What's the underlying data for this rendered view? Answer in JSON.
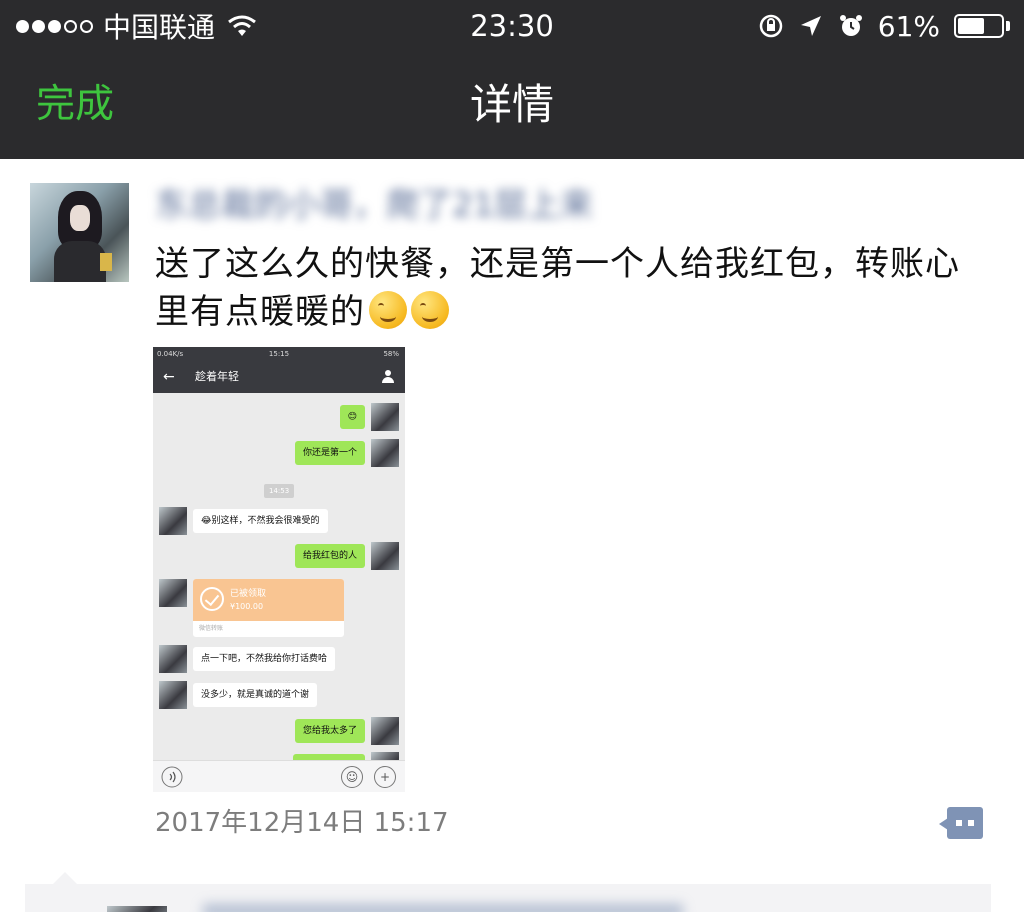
{
  "status_bar": {
    "carrier": "中国联通",
    "time": "23:30",
    "battery": "61%",
    "battery_level": 0.61,
    "icons": [
      "signal-dots",
      "wifi-icon",
      "rotation-lock-icon",
      "location-arrow-icon",
      "alarm-icon",
      "battery-icon"
    ]
  },
  "nav": {
    "done_label": "完成",
    "title": "详情"
  },
  "post": {
    "author": "东总裁的小哥，爬了21层上来",
    "text_line1": "送了这么久的快餐，还是第一个人给我红包，转账心",
    "text_line2": "里有点暖暖的",
    "emoji_count": 2,
    "date": "2017年12月14日 15:17"
  },
  "screenshot": {
    "status_left": "0.04K/s",
    "status_time": "15:15",
    "status_right": "58%",
    "back": "←",
    "title": "趁着年轻",
    "messages": [
      {
        "side": "right",
        "text": "😊"
      },
      {
        "side": "right",
        "text": "你还是第一个"
      },
      {
        "side": "time",
        "text": "14:53"
      },
      {
        "side": "left",
        "text": "😂别这样，不然我会很难受的"
      },
      {
        "side": "right",
        "text": "给我红包的人"
      },
      {
        "side": "left",
        "text": "点一下吧，不然我给你打话费哈"
      },
      {
        "side": "left",
        "text": "没多少，就是真诚的道个谢"
      },
      {
        "side": "right",
        "text": "您给我太多了"
      }
    ],
    "red_packet": {
      "status": "已被领取",
      "amount": "¥100.00",
      "footer": "微信转账"
    },
    "voice_icon": "voice-icon",
    "emoji_btn": "☺",
    "plus_btn": "+"
  },
  "colors": {
    "bar_bg": "#2b2b2d",
    "accent_green": "#3ec53e",
    "link_blue": "#576b95",
    "bubble_green": "#9fe658",
    "red_packet_orange": "#f9c592"
  }
}
